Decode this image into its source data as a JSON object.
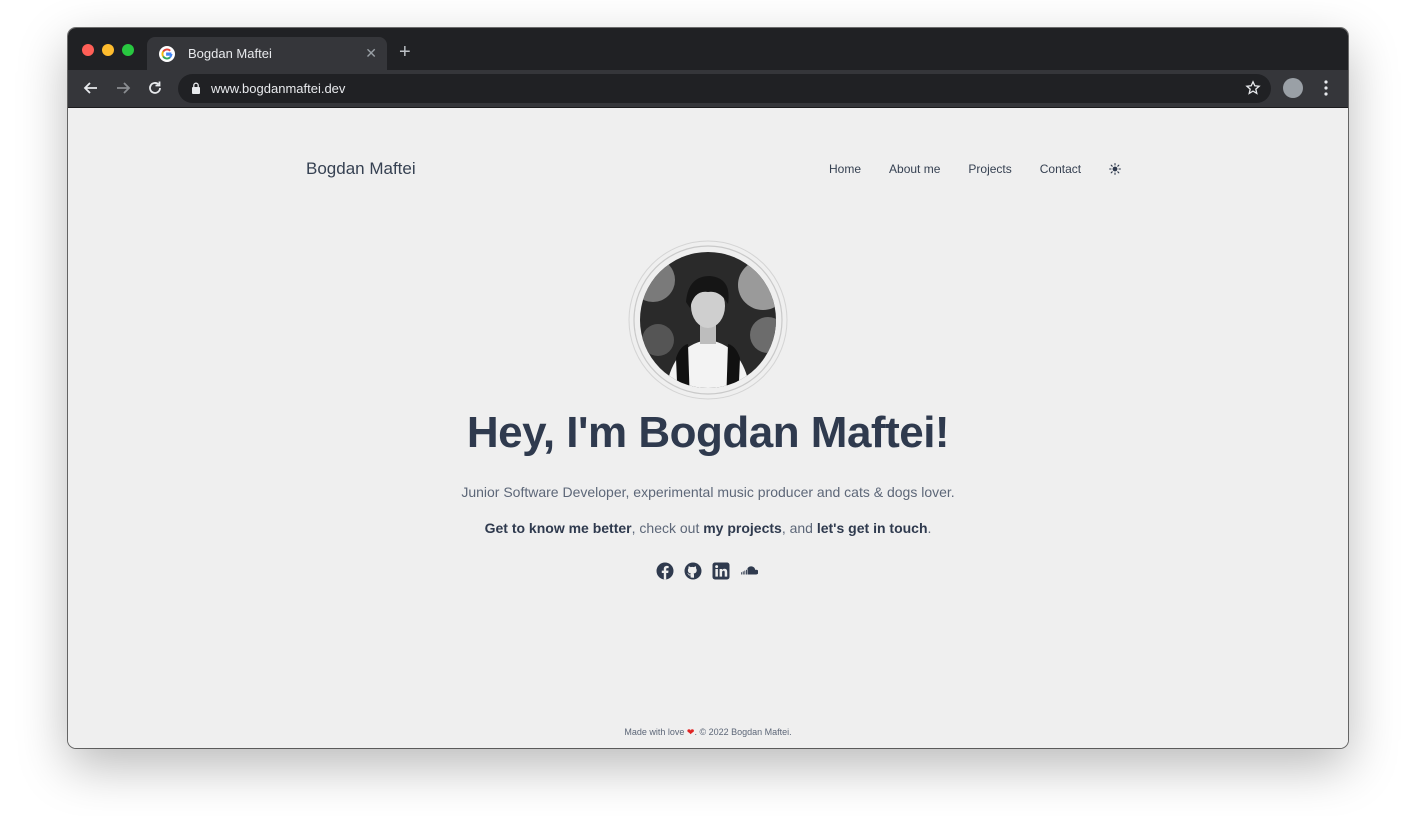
{
  "browser": {
    "tab_title": "Bogdan Maftei",
    "url": "www.bogdanmaftei.dev",
    "icons": {
      "back": "arrow-left-icon",
      "forward": "arrow-right-icon",
      "reload": "reload-icon",
      "bookmark": "star-icon",
      "menu": "kebab-menu-icon"
    }
  },
  "site": {
    "name": "Bogdan Maftei",
    "nav": {
      "home": "Home",
      "about": "About me",
      "projects": "Projects",
      "contact": "Contact"
    },
    "theme_icon": "sun-icon"
  },
  "hero": {
    "title": "Hey, I'm Bogdan Maftei!",
    "subtitle": "Junior Software Developer, experimental music producer and cats & dogs lover.",
    "cta": {
      "link1": "Get to know me better",
      "sep1": ", check out ",
      "link2": "my projects",
      "sep2": ", and ",
      "link3": "let's get in touch",
      "end": "."
    },
    "socials": [
      "facebook-icon",
      "github-icon",
      "linkedin-icon",
      "soundcloud-icon"
    ]
  },
  "footer": {
    "pre": "Made with love",
    "post": ". © 2022 Bogdan Maftei."
  },
  "colors": {
    "page_bg": "#efefef",
    "text_dark": "#2f3a4e",
    "heart": "#e02424",
    "chrome_frame": "#202124",
    "chrome_toolbar": "#35363a"
  }
}
